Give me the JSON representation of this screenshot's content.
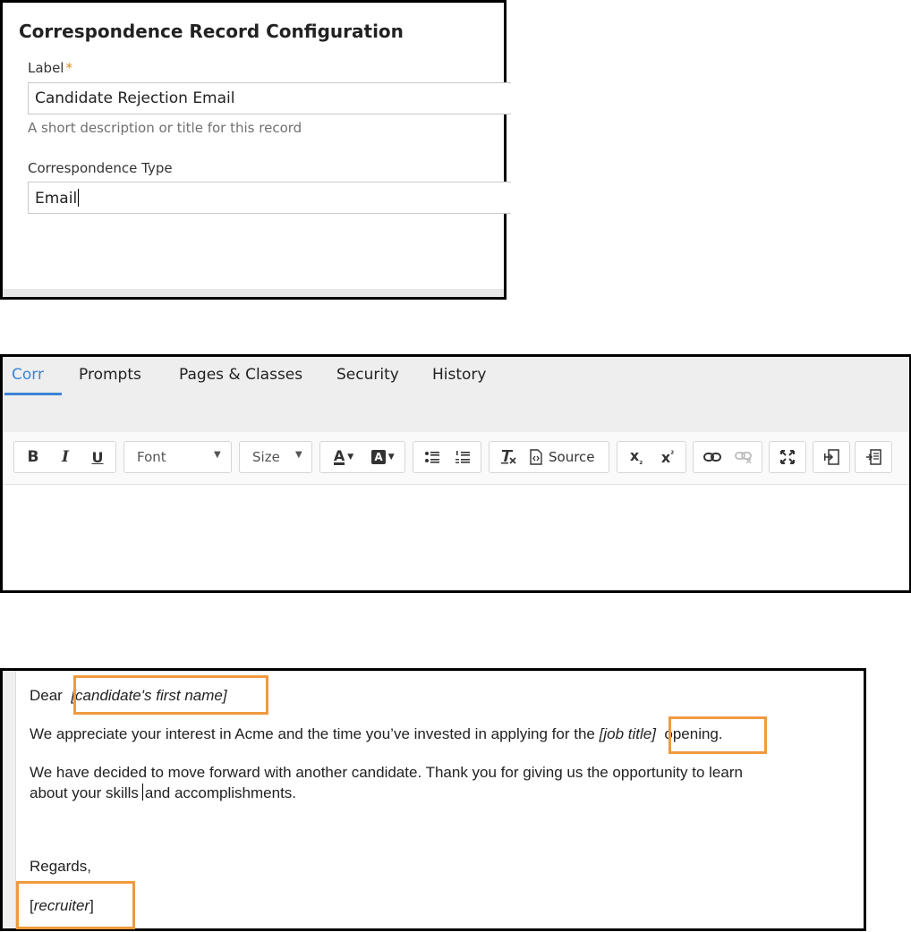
{
  "config": {
    "title": "Correspondence Record Configuration",
    "label_field": {
      "label": "Label",
      "required_mark": "*",
      "value": "Candidate Rejection Email",
      "help": "A short description or title for this record"
    },
    "type_field": {
      "label": "Correspondence Type",
      "value": "Email"
    }
  },
  "tabs": [
    "Corr",
    "Prompts",
    "Pages & Classes",
    "Security",
    "History"
  ],
  "toolbar": {
    "bold": "B",
    "italic": "I",
    "underline": "U",
    "font_label": "Font",
    "size_label": "Size",
    "text_color": "A",
    "bg_color": "A",
    "source_label": "Source"
  },
  "email": {
    "greeting": "Dear",
    "ph_first_name": "[candidate's first name]",
    "line2_start": "We appreciate your interest in Acme and the time you’ve invested in applying for the",
    "ph_job_title": "[job title]",
    "line2_end": "opening.",
    "line3a": "We have decided to move forward with another candidate. Thank you for giving us the opportunity to learn",
    "line3b_start": "about your skills",
    "line3b_end": "and accomplishments.",
    "regards": "Regards,",
    "ph_recruiter": "recruiter",
    "bracket_open": "[",
    "bracket_close": "]"
  },
  "colors": {
    "accent": "#3b85d6",
    "required": "#e08a22",
    "highlight": "#f09a3e"
  }
}
